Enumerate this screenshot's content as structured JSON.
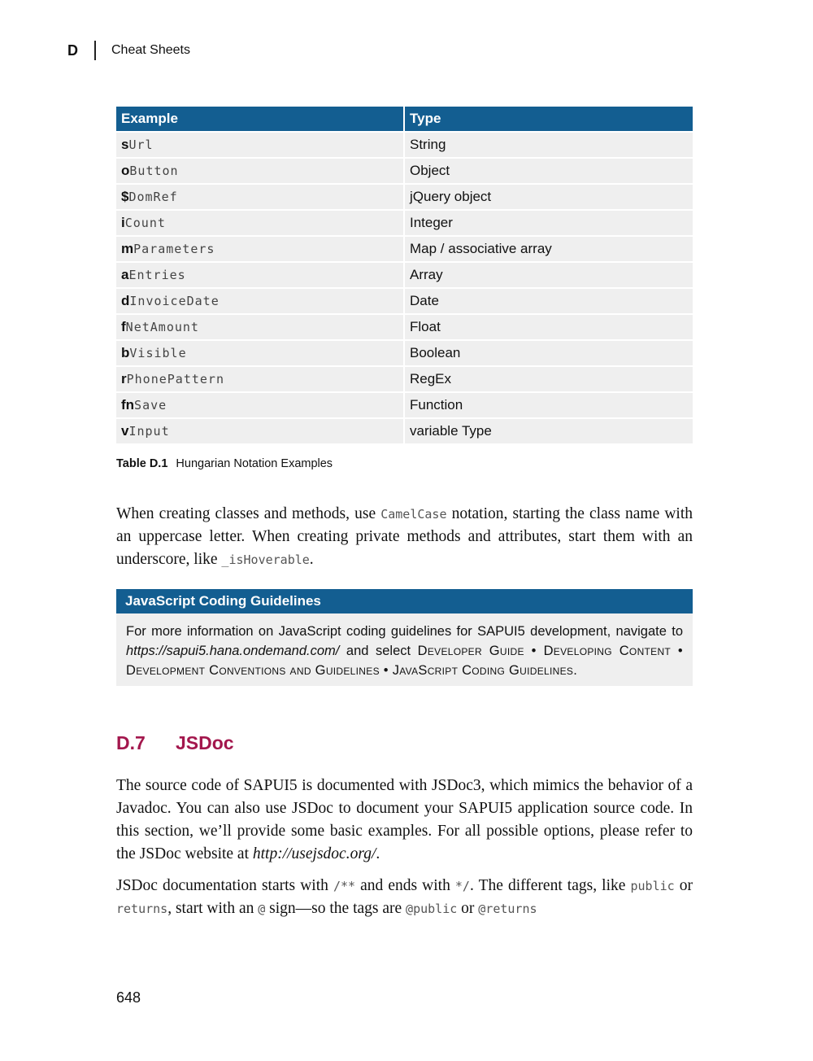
{
  "header": {
    "chapter_letter": "D",
    "chapter_title": "Cheat Sheets"
  },
  "table": {
    "columns": [
      "Example",
      "Type"
    ],
    "rows": [
      {
        "prefix": "s",
        "rest": "Url",
        "type": "String"
      },
      {
        "prefix": "o",
        "rest": "Button",
        "type": "Object"
      },
      {
        "prefix": "$",
        "rest": "DomRef",
        "type": "jQuery object"
      },
      {
        "prefix": "i",
        "rest": "Count",
        "type": "Integer"
      },
      {
        "prefix": "m",
        "rest": "Parameters",
        "type": "Map / associative array"
      },
      {
        "prefix": "a",
        "rest": "Entries",
        "type": "Array"
      },
      {
        "prefix": "d",
        "rest": "InvoiceDate",
        "type": "Date"
      },
      {
        "prefix": "f",
        "rest": "NetAmount",
        "type": "Float"
      },
      {
        "prefix": "b",
        "rest": "Visible",
        "type": "Boolean"
      },
      {
        "prefix": "r",
        "rest": "PhonePattern",
        "type": "RegEx"
      },
      {
        "prefix": "fn",
        "rest": "Save",
        "type": "Function"
      },
      {
        "prefix": "v",
        "rest": "Input",
        "type": "variable Type"
      }
    ],
    "caption_label": "Table D.1",
    "caption_text": "Hungarian Notation Examples"
  },
  "para1": {
    "t1": "When creating classes and methods, use ",
    "c1": "CamelCase",
    "t2": " notation, starting the class name with an uppercase letter. When creating private methods and attributes, start them with an underscore, like ",
    "c2": "_isHoverable",
    "t3": "."
  },
  "box": {
    "title": "JavaScript Coding Guidelines",
    "t1": "For more information on JavaScript coding guidelines for SAPUI5 development, navigate to ",
    "link": "https://sapui5.hana.ondemand.com/",
    "t2": " and select ",
    "path": "Developer Guide • Developing Content • Development Conventions and Guidelines • JavaScript Coding Guidelines",
    "t3": "."
  },
  "section": {
    "number": "D.7",
    "title": "JSDoc"
  },
  "para2": {
    "t1": "The source code of SAPUI5 is documented with JSDoc3, which mimics the behavior of a Javadoc. You can also use JSDoc to document your SAPUI5 application source code. In this section, we’ll provide some basic examples. For all possible options, please refer to the JSDoc website at ",
    "link": "http://usejsdoc.org/",
    "t2": "."
  },
  "para3": {
    "t1": "JSDoc documentation starts with ",
    "c1": "/**",
    "t2": " and ends with ",
    "c2": "*/",
    "t3": ". The different tags, like ",
    "c3": "public",
    "t4": " or ",
    "c4": "returns",
    "t5": ", start with an ",
    "c5": "@",
    "t6": " sign—so the tags are ",
    "c6": "@public",
    "t7": " or ",
    "c7": "@returns"
  },
  "page_number": "648"
}
